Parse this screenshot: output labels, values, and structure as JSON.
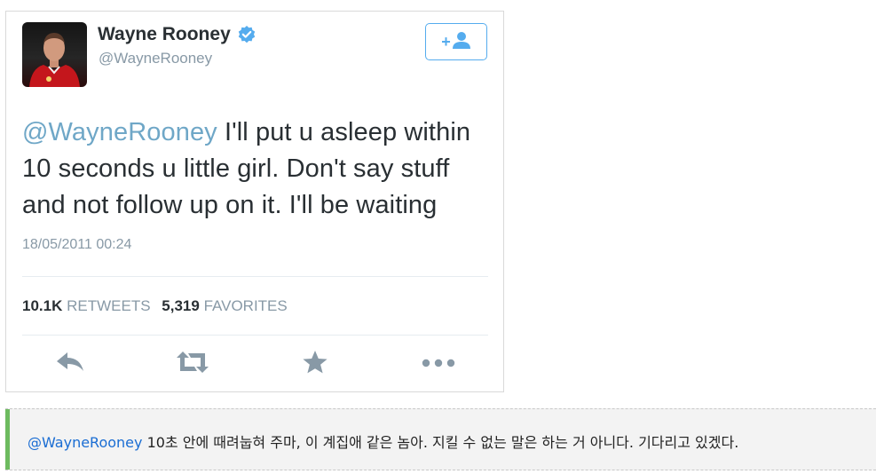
{
  "tweet": {
    "author_name": "Wayne Rooney",
    "author_handle": "@WayneRooney",
    "text_mention": "@WayneRooney",
    "text_body": " I'll put u asleep within 10 seconds u little girl. Don't say stuff and not follow up on it. I'll be waiting",
    "timestamp": "18/05/2011 00:24",
    "retweets_count": "10.1K",
    "retweets_label": "RETWEETS",
    "favorites_count": "5,319",
    "favorites_label": "FAVORITES",
    "follow_button_label": "+",
    "icons": {
      "verified": "verified-badge-icon",
      "follow": "add-user-icon",
      "reply": "reply-icon",
      "retweet": "retweet-icon",
      "favorite": "star-icon",
      "more": "more-dots-icon"
    }
  },
  "caption": {
    "mention": "@WayneRooney",
    "text": " 10초 안에 때려눕혀 주마, 이 계집애 같은 놈아. 지킬 수 없는 말은 하는 거 아니다. 기다리고 있겠다."
  },
  "colors": {
    "accent": "#55acee",
    "verified": "#55acee",
    "icon_gray": "#8899a6",
    "caption_accent": "#6dbb5f",
    "caption_link": "#1a6dd3"
  }
}
